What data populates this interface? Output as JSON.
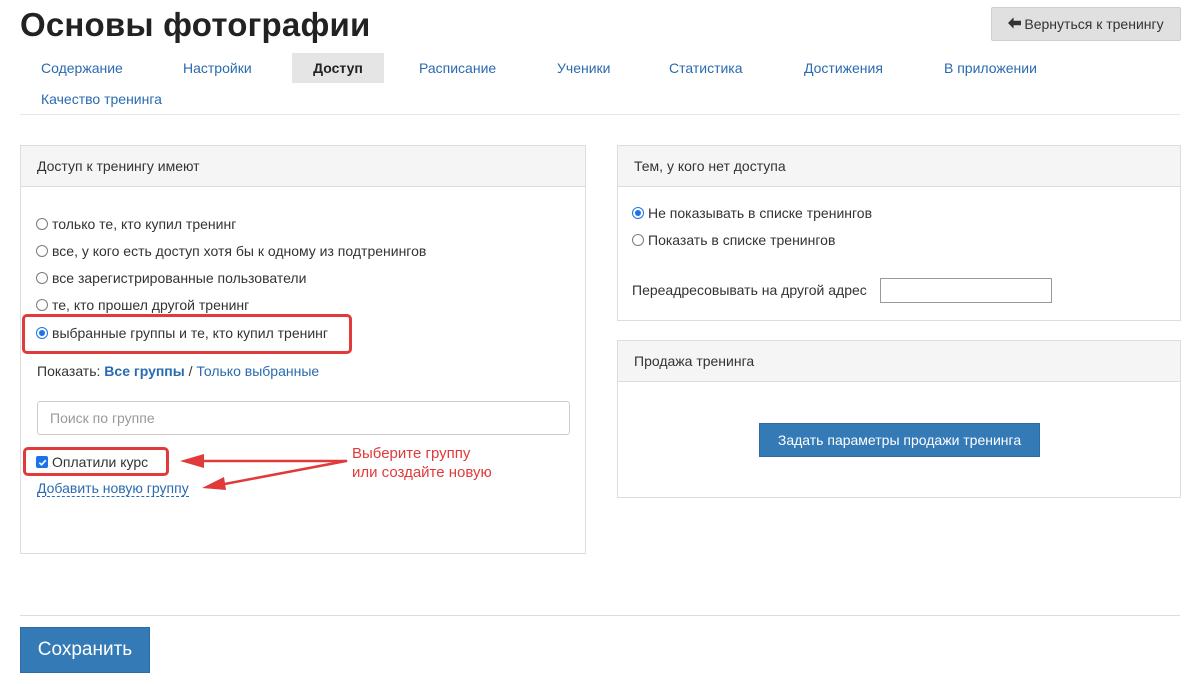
{
  "header": {
    "title": "Основы фотографии",
    "back_button": {
      "label": "Вернуться к тренингу",
      "icon": "arrow-left-icon"
    }
  },
  "tabs": [
    {
      "label": "Содержание",
      "active": false
    },
    {
      "label": "Настройки",
      "active": false
    },
    {
      "label": "Доступ",
      "active": true
    },
    {
      "label": "Расписание",
      "active": false
    },
    {
      "label": "Ученики",
      "active": false
    },
    {
      "label": "Статистика",
      "active": false
    },
    {
      "label": "Достижения",
      "active": false
    },
    {
      "label": "В приложении",
      "active": false
    },
    {
      "label": "Качество тренинга",
      "active": false
    }
  ],
  "access_panel": {
    "title": "Доступ к тренингу имеют",
    "options": [
      {
        "label": "только те, кто купил тренинг",
        "selected": false
      },
      {
        "label": "все, у кого есть доступ хотя бы к одному из подтренингов",
        "selected": false
      },
      {
        "label": "все зарегистрированные пользователи",
        "selected": false
      },
      {
        "label": "те, кто прошел другой тренинг",
        "selected": false
      },
      {
        "label": "выбранные группы и те, кто купил тренинг",
        "selected": true
      }
    ],
    "show_filter": {
      "prefix": "Показать:",
      "all_groups": "Все группы",
      "separator": "/",
      "selected_only": "Только выбранные"
    },
    "search": {
      "placeholder": "Поиск по группе",
      "value": ""
    },
    "groups": [
      {
        "label": "Оплатили курс",
        "checked": true
      }
    ],
    "add_group_link": "Добавить новую группу"
  },
  "annotation": {
    "line1": "Выберите группу",
    "line2": "или создайте новую",
    "color": "#e03a3a"
  },
  "no_access_panel": {
    "title": "Тем, у кого нет доступа",
    "options": [
      {
        "label": "Не показывать в списке тренингов",
        "selected": true
      },
      {
        "label": "Показать в списке тренингов",
        "selected": false
      }
    ],
    "redirect_label": "Переадресовывать на другой адрес",
    "redirect_value": ""
  },
  "sale_panel": {
    "title": "Продажа тренинга",
    "button_label": "Задать параметры продажи тренинга"
  },
  "footer": {
    "save_label": "Сохранить"
  },
  "colors": {
    "accent": "#337ab7",
    "link": "#2a6ab0",
    "highlight": "#e03a3a",
    "radio": "#1a73e8"
  }
}
